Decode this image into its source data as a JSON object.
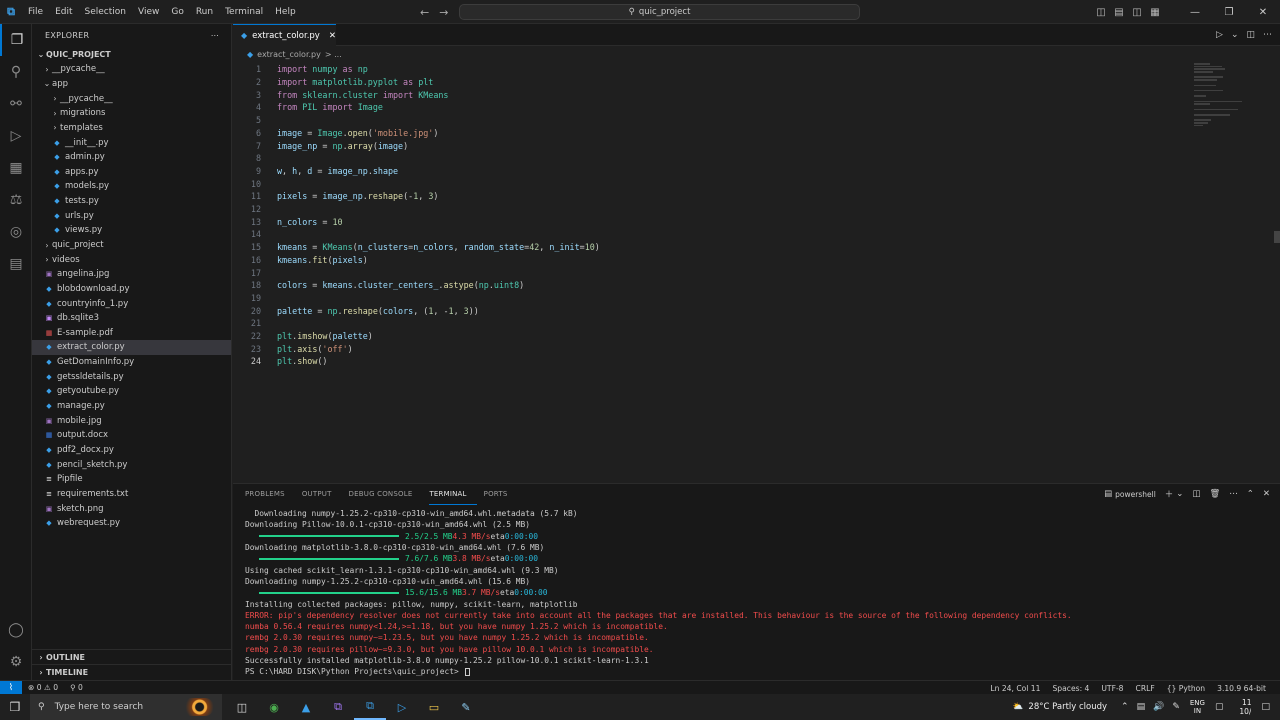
{
  "menu": [
    "File",
    "Edit",
    "Selection",
    "View",
    "Go",
    "Run",
    "Terminal",
    "Help"
  ],
  "search": {
    "label": "quic_project"
  },
  "activity": [
    "explorer-icon",
    "search-icon",
    "source-control-icon",
    "run-debug-icon",
    "extensions-icon",
    "testing-icon",
    "remote-icon",
    "terminal-icon"
  ],
  "sidebar": {
    "title": "EXPLORER",
    "project": "QUIC_PROJECT",
    "tree": [
      {
        "label": "__pycache__",
        "depth": 1,
        "type": "folder",
        "open": false
      },
      {
        "label": "app",
        "depth": 1,
        "type": "folder",
        "open": true
      },
      {
        "label": "__pycache__",
        "depth": 2,
        "type": "folder",
        "open": false
      },
      {
        "label": "migrations",
        "depth": 2,
        "type": "folder",
        "open": false
      },
      {
        "label": "templates",
        "depth": 2,
        "type": "folder",
        "open": false
      },
      {
        "label": "__init__.py",
        "depth": 2,
        "type": "py"
      },
      {
        "label": "admin.py",
        "depth": 2,
        "type": "py"
      },
      {
        "label": "apps.py",
        "depth": 2,
        "type": "py"
      },
      {
        "label": "models.py",
        "depth": 2,
        "type": "py"
      },
      {
        "label": "tests.py",
        "depth": 2,
        "type": "py"
      },
      {
        "label": "urls.py",
        "depth": 2,
        "type": "py"
      },
      {
        "label": "views.py",
        "depth": 2,
        "type": "py"
      },
      {
        "label": "quic_project",
        "depth": 1,
        "type": "folder",
        "open": false
      },
      {
        "label": "videos",
        "depth": 1,
        "type": "folder",
        "open": false
      },
      {
        "label": "angelina.jpg",
        "depth": 1,
        "type": "img"
      },
      {
        "label": "blobdownload.py",
        "depth": 1,
        "type": "py"
      },
      {
        "label": "countryinfo_1.py",
        "depth": 1,
        "type": "py"
      },
      {
        "label": "db.sqlite3",
        "depth": 1,
        "type": "db"
      },
      {
        "label": "E-sample.pdf",
        "depth": 1,
        "type": "pdf"
      },
      {
        "label": "extract_color.py",
        "depth": 1,
        "type": "py",
        "selected": true
      },
      {
        "label": "GetDomainInfo.py",
        "depth": 1,
        "type": "py"
      },
      {
        "label": "getssldetails.py",
        "depth": 1,
        "type": "py"
      },
      {
        "label": "getyoutube.py",
        "depth": 1,
        "type": "py"
      },
      {
        "label": "manage.py",
        "depth": 1,
        "type": "py"
      },
      {
        "label": "mobile.jpg",
        "depth": 1,
        "type": "img"
      },
      {
        "label": "output.docx",
        "depth": 1,
        "type": "doc"
      },
      {
        "label": "pdf2_docx.py",
        "depth": 1,
        "type": "py"
      },
      {
        "label": "pencil_sketch.py",
        "depth": 1,
        "type": "py"
      },
      {
        "label": "Pipfile",
        "depth": 1,
        "type": "txt"
      },
      {
        "label": "requirements.txt",
        "depth": 1,
        "type": "txt"
      },
      {
        "label": "sketch.png",
        "depth": 1,
        "type": "img"
      },
      {
        "label": "webrequest.py",
        "depth": 1,
        "type": "py"
      }
    ],
    "outline": "OUTLINE",
    "timeline": "TIMELINE"
  },
  "editor": {
    "tab": "extract_color.py",
    "breadcrumb": "extract_color.py",
    "breadcrumb_tail": "> ...",
    "current_line": 24,
    "lines": [
      [
        [
          "kw",
          "import "
        ],
        [
          "cls",
          "numpy"
        ],
        [
          "kw",
          " as "
        ],
        [
          "cls",
          "np"
        ]
      ],
      [
        [
          "kw",
          "import "
        ],
        [
          "cls",
          "matplotlib.pyplot"
        ],
        [
          "kw",
          " as "
        ],
        [
          "cls",
          "plt"
        ]
      ],
      [
        [
          "kw",
          "from "
        ],
        [
          "cls",
          "sklearn.cluster"
        ],
        [
          "kw",
          " import "
        ],
        [
          "cls",
          "KMeans"
        ]
      ],
      [
        [
          "kw",
          "from "
        ],
        [
          "cls",
          "PIL"
        ],
        [
          "kw",
          " import "
        ],
        [
          "cls",
          "Image"
        ]
      ],
      [],
      [
        [
          "var",
          "image"
        ],
        [
          "plain",
          " = "
        ],
        [
          "cls",
          "Image"
        ],
        [
          "plain",
          "."
        ],
        [
          "fn",
          "open"
        ],
        [
          "plain",
          "("
        ],
        [
          "str",
          "'mobile.jpg'"
        ],
        [
          "plain",
          ")"
        ]
      ],
      [
        [
          "var",
          "image_np"
        ],
        [
          "plain",
          " = "
        ],
        [
          "cls",
          "np"
        ],
        [
          "plain",
          "."
        ],
        [
          "fn",
          "array"
        ],
        [
          "plain",
          "("
        ],
        [
          "var",
          "image"
        ],
        [
          "plain",
          ")"
        ]
      ],
      [],
      [
        [
          "var",
          "w"
        ],
        [
          "plain",
          ", "
        ],
        [
          "var",
          "h"
        ],
        [
          "plain",
          ", "
        ],
        [
          "var",
          "d"
        ],
        [
          "plain",
          " = "
        ],
        [
          "var",
          "image_np"
        ],
        [
          "plain",
          "."
        ],
        [
          "var",
          "shape"
        ]
      ],
      [],
      [
        [
          "var",
          "pixels"
        ],
        [
          "plain",
          " = "
        ],
        [
          "var",
          "image_np"
        ],
        [
          "plain",
          "."
        ],
        [
          "fn",
          "reshape"
        ],
        [
          "plain",
          "(-"
        ],
        [
          "num",
          "1"
        ],
        [
          "plain",
          ", "
        ],
        [
          "num",
          "3"
        ],
        [
          "plain",
          ")"
        ]
      ],
      [],
      [
        [
          "var",
          "n_colors"
        ],
        [
          "plain",
          " = "
        ],
        [
          "num",
          "10"
        ]
      ],
      [],
      [
        [
          "var",
          "kmeans"
        ],
        [
          "plain",
          " = "
        ],
        [
          "cls",
          "KMeans"
        ],
        [
          "plain",
          "("
        ],
        [
          "var",
          "n_clusters"
        ],
        [
          "plain",
          "="
        ],
        [
          "var",
          "n_colors"
        ],
        [
          "plain",
          ", "
        ],
        [
          "var",
          "random_state"
        ],
        [
          "plain",
          "="
        ],
        [
          "num",
          "42"
        ],
        [
          "plain",
          ", "
        ],
        [
          "var",
          "n_init"
        ],
        [
          "plain",
          "="
        ],
        [
          "num",
          "10"
        ],
        [
          "plain",
          ")"
        ]
      ],
      [
        [
          "var",
          "kmeans"
        ],
        [
          "plain",
          "."
        ],
        [
          "fn",
          "fit"
        ],
        [
          "plain",
          "("
        ],
        [
          "var",
          "pixels"
        ],
        [
          "plain",
          ")"
        ]
      ],
      [],
      [
        [
          "var",
          "colors"
        ],
        [
          "plain",
          " = "
        ],
        [
          "var",
          "kmeans"
        ],
        [
          "plain",
          "."
        ],
        [
          "var",
          "cluster_centers_"
        ],
        [
          "plain",
          "."
        ],
        [
          "fn",
          "astype"
        ],
        [
          "plain",
          "("
        ],
        [
          "cls",
          "np"
        ],
        [
          "plain",
          "."
        ],
        [
          "cls",
          "uint8"
        ],
        [
          "plain",
          ")"
        ]
      ],
      [],
      [
        [
          "var",
          "palette"
        ],
        [
          "plain",
          " = "
        ],
        [
          "cls",
          "np"
        ],
        [
          "plain",
          "."
        ],
        [
          "fn",
          "reshape"
        ],
        [
          "plain",
          "("
        ],
        [
          "var",
          "colors"
        ],
        [
          "plain",
          ", ("
        ],
        [
          "num",
          "1"
        ],
        [
          "plain",
          ", -"
        ],
        [
          "num",
          "1"
        ],
        [
          "plain",
          ", "
        ],
        [
          "num",
          "3"
        ],
        [
          "plain",
          "))"
        ]
      ],
      [],
      [
        [
          "cls",
          "plt"
        ],
        [
          "plain",
          "."
        ],
        [
          "fn",
          "imshow"
        ],
        [
          "plain",
          "("
        ],
        [
          "var",
          "palette"
        ],
        [
          "plain",
          ")"
        ]
      ],
      [
        [
          "cls",
          "plt"
        ],
        [
          "plain",
          "."
        ],
        [
          "fn",
          "axis"
        ],
        [
          "plain",
          "("
        ],
        [
          "str",
          "'off'"
        ],
        [
          "plain",
          ")"
        ]
      ],
      [
        [
          "cls",
          "plt"
        ],
        [
          "plain",
          "."
        ],
        [
          "fn",
          "show"
        ],
        [
          "plain",
          "()"
        ]
      ]
    ]
  },
  "panel": {
    "tabs": [
      "PROBLEMS",
      "OUTPUT",
      "DEBUG CONSOLE",
      "TERMINAL",
      "PORTS"
    ],
    "active_tab": "TERMINAL",
    "shell": "powershell",
    "terminal": [
      {
        "t": "plain",
        "text": "  Downloading numpy-1.25.2-cp310-cp310-win_amd64.whl.metadata (5.7 kB)"
      },
      {
        "t": "plain",
        "text": "Downloading Pillow-10.0.1-cp310-cp310-win_amd64.whl (2.5 MB)"
      },
      {
        "t": "progress",
        "done": "2.5/2.5 MB",
        "rate": "4.3 MB/s",
        "eta": "eta",
        "time": "0:00:00"
      },
      {
        "t": "plain",
        "text": "Downloading matplotlib-3.8.0-cp310-cp310-win_amd64.whl (7.6 MB)"
      },
      {
        "t": "progress",
        "done": "7.6/7.6 MB",
        "rate": "3.8 MB/s",
        "eta": "eta",
        "time": "0:00:00"
      },
      {
        "t": "plain",
        "text": "Using cached scikit_learn-1.3.1-cp310-cp310-win_amd64.whl (9.3 MB)"
      },
      {
        "t": "plain",
        "text": "Downloading numpy-1.25.2-cp310-cp310-win_amd64.whl (15.6 MB)"
      },
      {
        "t": "progress",
        "done": "15.6/15.6 MB",
        "rate": "3.7 MB/s",
        "eta": "eta",
        "time": "0:00:00"
      },
      {
        "t": "plain",
        "text": "Installing collected packages: pillow, numpy, scikit-learn, matplotlib"
      },
      {
        "t": "err",
        "text": "ERROR: pip's dependency resolver does not currently take into account all the packages that are installed. This behaviour is the source of the following dependency conflicts."
      },
      {
        "t": "err",
        "text": "numba 0.56.4 requires numpy<1.24,>=1.18, but you have numpy 1.25.2 which is incompatible."
      },
      {
        "t": "err",
        "text": "rembg 2.0.30 requires numpy~=1.23.5, but you have numpy 1.25.2 which is incompatible."
      },
      {
        "t": "err",
        "text": "rembg 2.0.30 requires pillow~=9.3.0, but you have pillow 10.0.1 which is incompatible."
      },
      {
        "t": "plain",
        "text": "Successfully installed matplotlib-3.8.0 numpy-1.25.2 pillow-10.0.1 scikit-learn-1.3.1"
      },
      {
        "t": "plain",
        "text": "PS C:\\HARD DISK\\Python Projects\\quic_project> "
      }
    ]
  },
  "status": {
    "problems": "⊗ 0 ⚠ 0",
    "ports": "⚲ 0",
    "position": "Ln 24, Col 11",
    "spaces": "Spaces: 4",
    "encoding": "UTF-8",
    "eol": "CRLF",
    "language": "Python",
    "interpreter": "3.10.9 64-bit"
  },
  "taskbar": {
    "search_placeholder": "Type here to search",
    "weather": "28°C  Partly cloudy",
    "lang_top": "ENG",
    "lang_bottom": "IN",
    "time": "11",
    "date": "10/"
  }
}
